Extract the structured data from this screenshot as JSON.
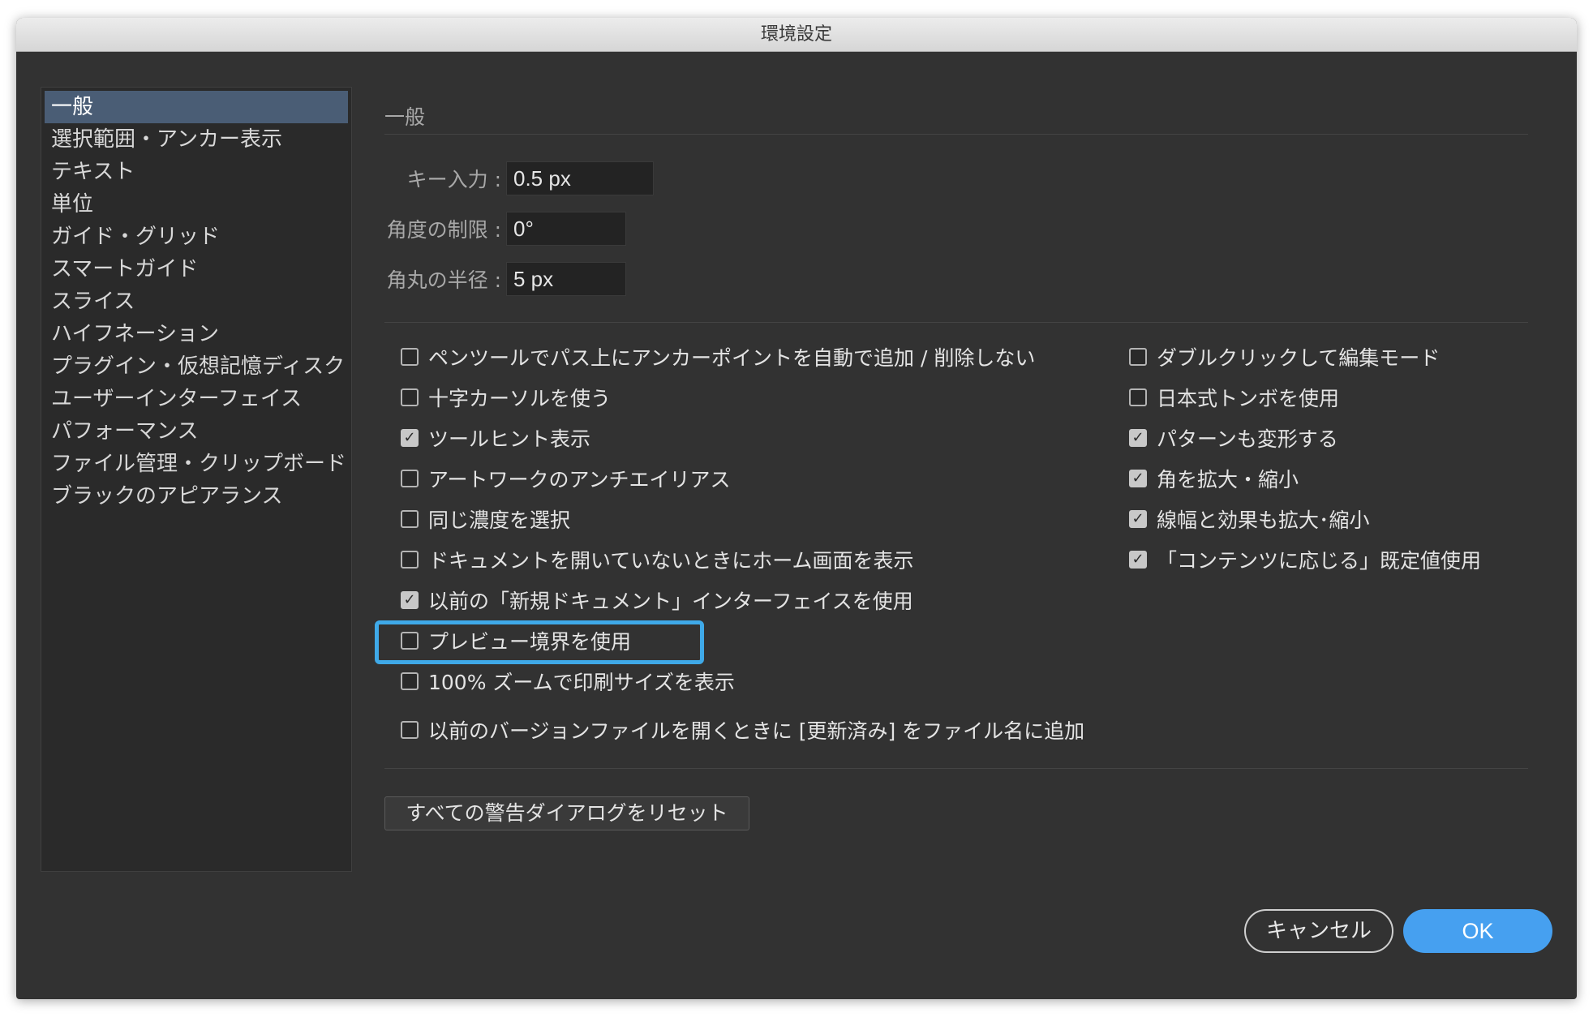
{
  "window": {
    "title": "環境設定"
  },
  "sidebar": {
    "items": [
      {
        "label": "一般",
        "selected": true
      },
      {
        "label": "選択範囲・アンカー表示",
        "selected": false
      },
      {
        "label": "テキスト",
        "selected": false
      },
      {
        "label": "単位",
        "selected": false
      },
      {
        "label": "ガイド・グリッド",
        "selected": false
      },
      {
        "label": "スマートガイド",
        "selected": false
      },
      {
        "label": "スライス",
        "selected": false
      },
      {
        "label": "ハイフネーション",
        "selected": false
      },
      {
        "label": "プラグイン・仮想記憶ディスク",
        "selected": false
      },
      {
        "label": "ユーザーインターフェイス",
        "selected": false
      },
      {
        "label": "パフォーマンス",
        "selected": false
      },
      {
        "label": "ファイル管理・クリップボード",
        "selected": false
      },
      {
        "label": "ブラックのアピアランス",
        "selected": false
      }
    ]
  },
  "general": {
    "title": "一般",
    "fields": {
      "key_input": {
        "label": "キー入力 :",
        "value": "0.5 px"
      },
      "angle_constraint": {
        "label": "角度の制限 :",
        "value": "0°"
      },
      "corner_radius": {
        "label": "角丸の半径 :",
        "value": "5 px"
      }
    },
    "options_left": [
      {
        "label": "ペンツールでパス上にアンカーポイントを自動で追加 / 削除しない",
        "checked": false
      },
      {
        "label": "十字カーソルを使う",
        "checked": false
      },
      {
        "label": "ツールヒント表示",
        "checked": true
      },
      {
        "label": "アートワークのアンチエイリアス",
        "checked": false
      },
      {
        "label": "同じ濃度を選択",
        "checked": false
      },
      {
        "label": "ドキュメントを開いていないときにホーム画面を表示",
        "checked": false
      },
      {
        "label": "以前の「新規ドキュメント」インターフェイスを使用",
        "checked": true
      },
      {
        "label": "プレビュー境界を使用",
        "checked": false
      },
      {
        "label": "100% ズームで印刷サイズを表示",
        "checked": false
      },
      {
        "label": "以前のバージョンファイルを開くときに [更新済み] をファイル名に追加",
        "checked": false
      }
    ],
    "options_right": [
      {
        "label": "ダブルクリックして編集モード",
        "checked": false
      },
      {
        "label": "日本式トンボを使用",
        "checked": false
      },
      {
        "label": "パターンも変形する",
        "checked": true
      },
      {
        "label": "角を拡大・縮小",
        "checked": true
      },
      {
        "label": "線幅と効果も拡大･縮小",
        "checked": true
      },
      {
        "label": "「コンテンツに応じる」既定値使用",
        "checked": true
      }
    ],
    "reset_label": "すべての警告ダイアログをリセット"
  },
  "footer": {
    "cancel_label": "キャンセル",
    "ok_label": "OK"
  },
  "colors": {
    "background": "#323232",
    "accent": "#46a0f0",
    "highlight": "#3fa9e8"
  }
}
